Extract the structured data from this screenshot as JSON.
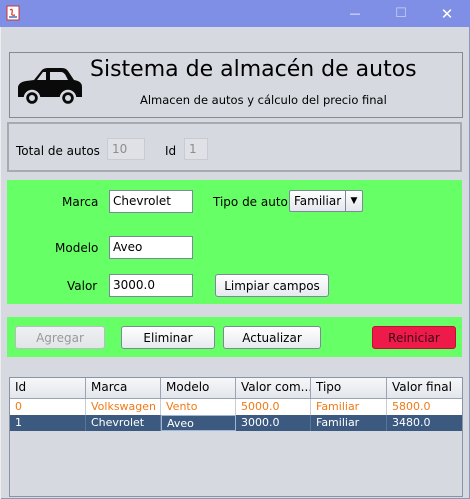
{
  "header": {
    "title": "Sistema de almacén de autos",
    "subtitle": "Almacen de autos y cálculo del precio final",
    "logo_icon": "car-icon"
  },
  "window_controls": {
    "minimize": "—",
    "maximize": "☐",
    "close": "✕"
  },
  "counter": {
    "total_label": "Total de autos",
    "total_value": "10",
    "id_label": "Id",
    "id_value": "1"
  },
  "form": {
    "marca_label": "Marca",
    "marca_value": "Chevrolet",
    "tipo_label": "Tipo de auto",
    "tipo_value": "Familiar",
    "modelo_label": "Modelo",
    "modelo_value": "Aveo",
    "valor_label": "Valor",
    "valor_value": "3000.0",
    "clear_label": "Limpiar campos"
  },
  "actions": {
    "add": "Agregar",
    "delete": "Eliminar",
    "update": "Actualizar",
    "reset": "Reiniciar"
  },
  "table": {
    "columns": [
      "Id",
      "Marca",
      "Modelo",
      "Valor com...",
      "Tipo",
      "Valor final"
    ],
    "rows": [
      [
        "0",
        "Volkswagen",
        "Vento",
        "5000.0",
        "Familiar",
        "5800.0"
      ],
      [
        "1",
        "Chevrolet",
        "Aveo",
        "3000.0",
        "Familiar",
        "3480.0"
      ]
    ],
    "selected_row": 1
  },
  "colors": {
    "titlebar": "#7f8fe6",
    "green_panel": "#66ff66",
    "reset_button": "#ee1a49",
    "selected_row": "#3c5a80",
    "row_text_orange": "#f07a16"
  }
}
